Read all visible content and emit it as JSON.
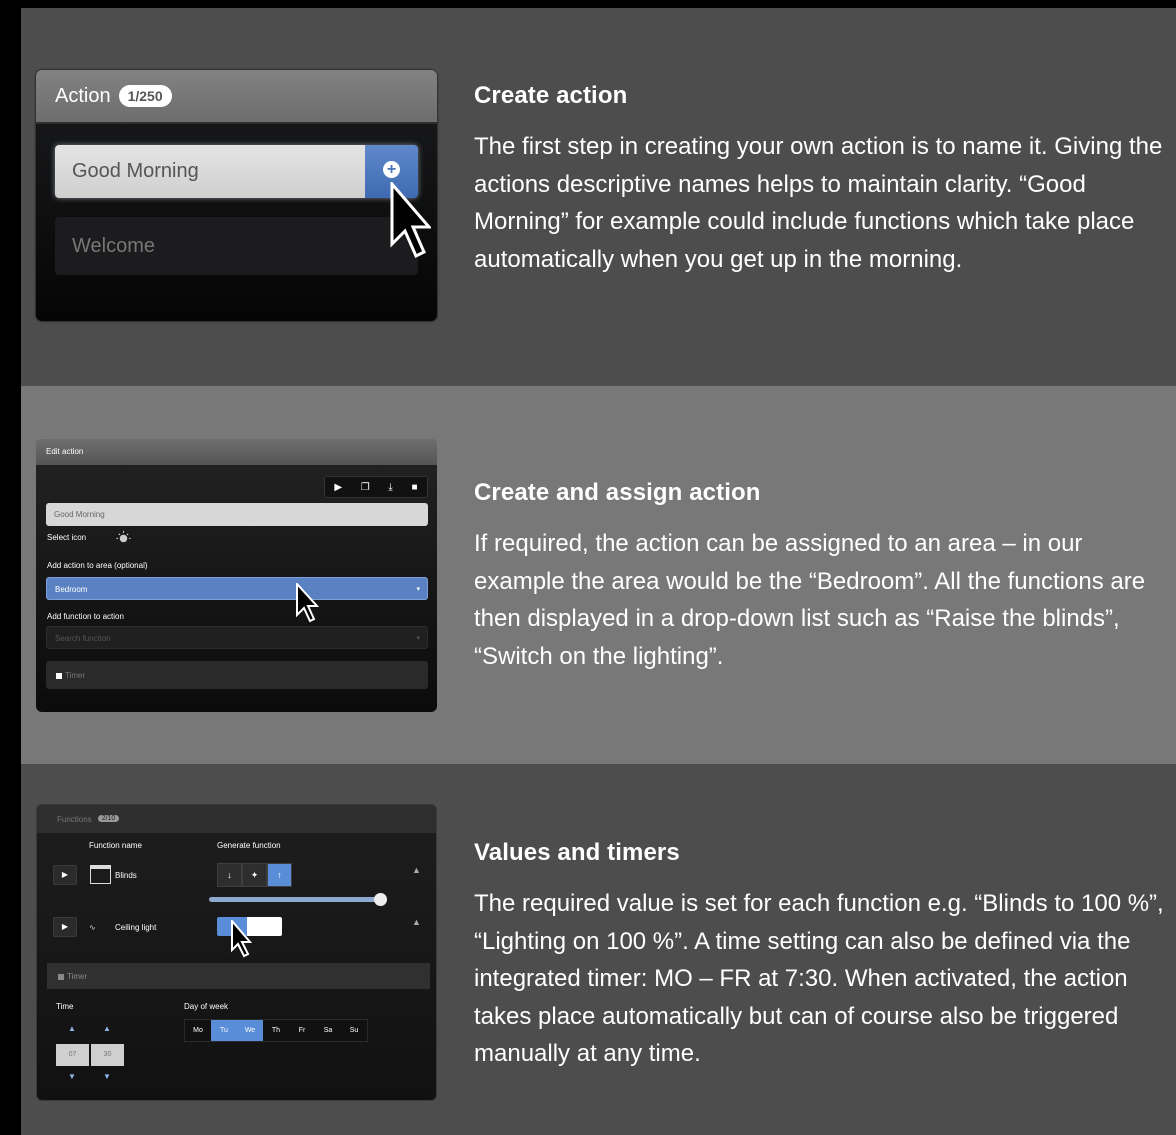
{
  "sections": [
    {
      "title": "Create action",
      "body": "The first step in creating your own action is to name it. Giving the actions descriptive names helps to maintain clarity. “Good Morning” for example could include functions which take place automatically when you get up in the morning."
    },
    {
      "title": "Create and assign action",
      "body": "If required, the action can be assigned to an area – in our example the area would be the “Bedroom”. All the functions are then displayed in a drop-down list such as “Raise the blinds”, “Switch on the lighting”."
    },
    {
      "title": "Values and timers",
      "body": "The required value is set for each function e.g. “Blinds to 100 %”, “Lighting on 100 %”. A time setting can also be defined via the integrated timer: MO – FR at 7:30. When activated, the action takes place automatically but can of course also be triggered manually at any time."
    }
  ],
  "panel1": {
    "header_title": "Action",
    "count_badge": "1/250",
    "name_input_value": "Good Morning",
    "add_icon": "plus-circle-icon",
    "list_item": "Welcome"
  },
  "panel2": {
    "header_title": "Edit action",
    "toolbar_icons": [
      "play-icon",
      "copy-icon",
      "download-icon",
      "trash-icon"
    ],
    "name_input_value": "Good Morning",
    "select_icon_label": "Select icon",
    "area_label": "Add action to area (optional)",
    "area_value": "Bedroom",
    "function_label": "Add function to action",
    "function_placeholder": "Search function",
    "timer_label": "Timer"
  },
  "panel3": {
    "header_title": "Functions",
    "header_badge": "2/10",
    "col_function_name": "Function name",
    "col_generate": "Generate function",
    "functions": [
      {
        "name": "Blinds",
        "icon": "blinds-icon"
      },
      {
        "name": "Ceiling light",
        "icon": "ceiling-light-icon"
      }
    ],
    "blinds_level": 1.0,
    "timer_label": "Timer",
    "time_label": "Time",
    "time_hour": "07",
    "time_minute": "30",
    "day_of_week_label": "Day of week",
    "days": [
      "Mo",
      "Tu",
      "We",
      "Th",
      "Fr",
      "Sa",
      "Su"
    ],
    "active_days": [
      "Tu",
      "We"
    ]
  },
  "colors": {
    "dark_band": "#4d4d4d",
    "light_band": "#787878",
    "accent_blue": "#5a8dd8"
  }
}
